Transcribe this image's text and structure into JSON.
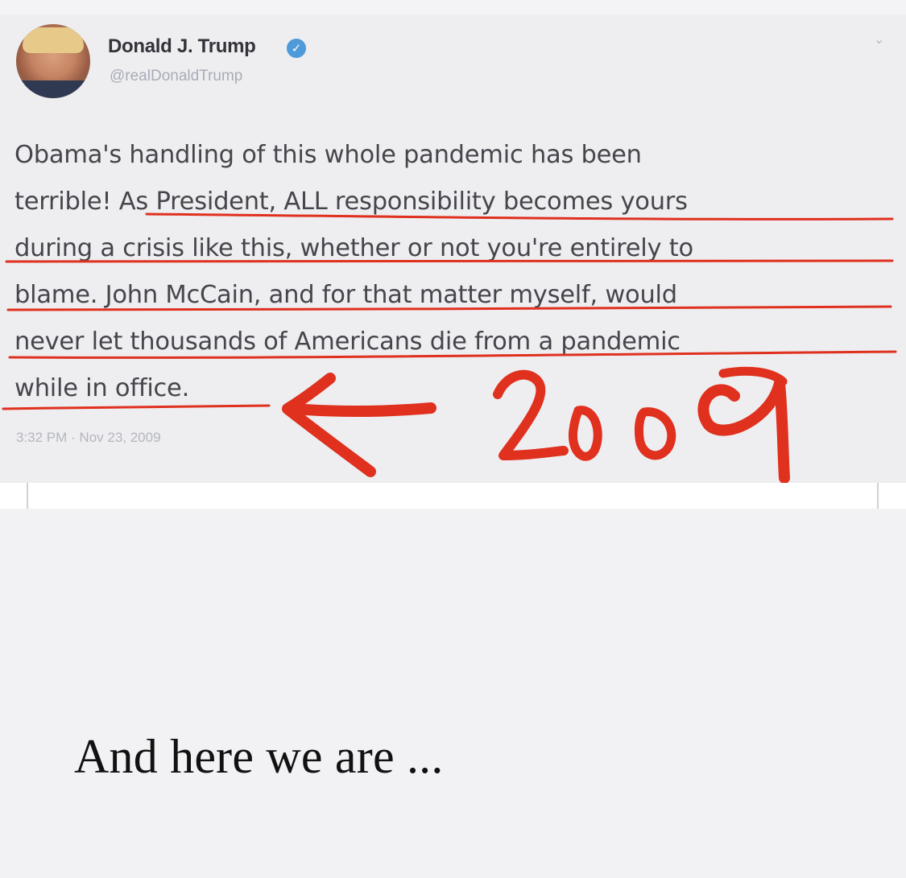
{
  "tweet": {
    "display_name": "Donald J. Trump",
    "handle": "@realDonaldTrump",
    "verified_icon": "verified-check-icon",
    "menu_icon": "chevron-down-icon",
    "text_lines": [
      "Obama's handling of this whole pandemic has been",
      "terrible! As President, ALL responsibility becomes yours",
      "during a crisis like this, whether or not you're entirely to",
      "blame. John McCain, and for that matter myself, would",
      "never let thousands of Americans die from a pandemic",
      "while in office."
    ],
    "timestamp": "3:32 PM · Nov 23, 2009"
  },
  "annotation": {
    "handwritten_year": "2009",
    "ink_color": "#e0301e",
    "arrow_icon": "left-arrow-icon"
  },
  "caption": "And here we are ..."
}
